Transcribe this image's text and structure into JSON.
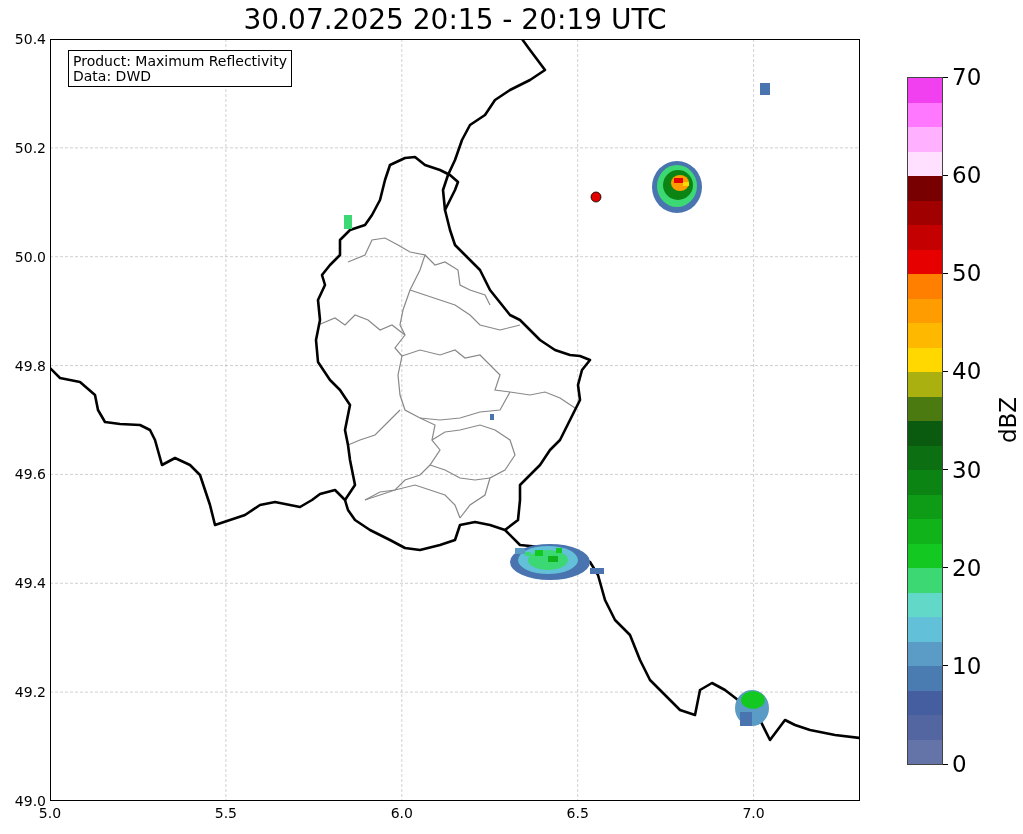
{
  "title": "30.07.2025 20:15 - 20:19 UTC",
  "info_box": {
    "lines": [
      "Product: Maximum Reflectivity",
      "Data: DWD"
    ]
  },
  "map": {
    "xticks": [
      "5.0",
      "5.5",
      "6.0",
      "6.5",
      "7.0"
    ],
    "yticks": [
      "50.4",
      "50.2",
      "50.0",
      "49.8",
      "49.6",
      "49.4",
      "49.2",
      "49.0"
    ]
  },
  "colorbar": {
    "label": "dBZ",
    "ticks": [
      "70",
      "60",
      "50",
      "40",
      "30",
      "20",
      "10",
      "0"
    ],
    "segments": [
      {
        "color": "#6474a8"
      },
      {
        "color": "#5466a2"
      },
      {
        "color": "#445ea0"
      },
      {
        "color": "#4a7cb2"
      },
      {
        "color": "#5a9cc6"
      },
      {
        "color": "#62c0d8"
      },
      {
        "color": "#62d8c8"
      },
      {
        "color": "#3cd874"
      },
      {
        "color": "#14c822"
      },
      {
        "color": "#10b41a"
      },
      {
        "color": "#0e9c16"
      },
      {
        "color": "#0c8414"
      },
      {
        "color": "#0c7012"
      },
      {
        "color": "#0a5a10"
      },
      {
        "color": "#4a7a10"
      },
      {
        "color": "#aab010"
      },
      {
        "color": "#ffd800"
      },
      {
        "color": "#ffb800"
      },
      {
        "color": "#ff9c00"
      },
      {
        "color": "#ff8000"
      },
      {
        "color": "#e60000"
      },
      {
        "color": "#c40000"
      },
      {
        "color": "#a00000"
      },
      {
        "color": "#780000"
      },
      {
        "color": "#ffe0ff"
      },
      {
        "color": "#ffb0ff"
      },
      {
        "color": "#ff78ff"
      },
      {
        "color": "#f040f0"
      }
    ]
  }
}
